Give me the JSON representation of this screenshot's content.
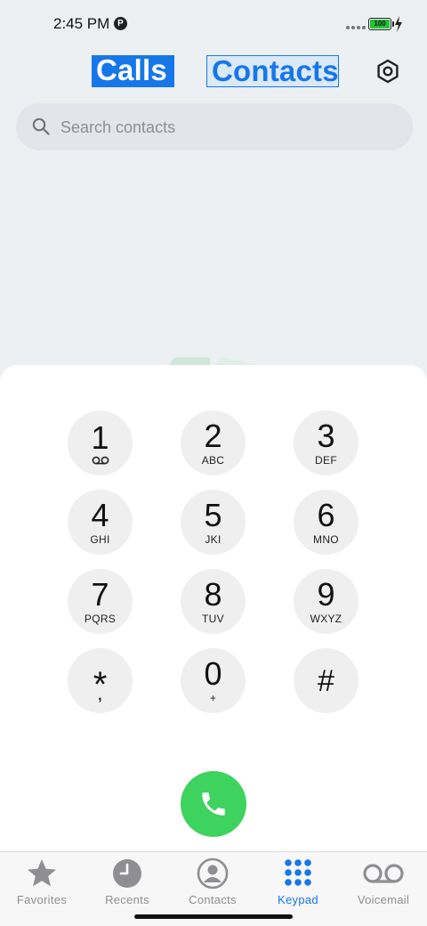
{
  "status": {
    "time": "2:45 PM",
    "pip_icon": "P",
    "battery_level": "100"
  },
  "header": {
    "tabs": [
      "Calls",
      "Contacts"
    ],
    "settings_icon": "gear-icon"
  },
  "search": {
    "placeholder": "Search contacts",
    "value": ""
  },
  "keypad": {
    "keys": [
      {
        "digit": "1",
        "sub": "",
        "icon": "voicemail-icon"
      },
      {
        "digit": "2",
        "sub": "ABC"
      },
      {
        "digit": "3",
        "sub": "DEF"
      },
      {
        "digit": "4",
        "sub": "GHI"
      },
      {
        "digit": "5",
        "sub": "JKI"
      },
      {
        "digit": "6",
        "sub": "MNO"
      },
      {
        "digit": "7",
        "sub": "PQRS"
      },
      {
        "digit": "8",
        "sub": "TUV"
      },
      {
        "digit": "9",
        "sub": "WXYZ"
      },
      {
        "digit": "*",
        "sub": ","
      },
      {
        "digit": "0",
        "sub": "+"
      },
      {
        "digit": "#",
        "sub": ""
      }
    ],
    "call_icon": "phone-icon"
  },
  "tabbar": {
    "items": [
      {
        "label": "Favorites",
        "icon": "star-icon"
      },
      {
        "label": "Recents",
        "icon": "clock-icon"
      },
      {
        "label": "Contacts",
        "icon": "person-circle-icon"
      },
      {
        "label": "Keypad",
        "icon": "keypad-icon"
      },
      {
        "label": "Voicemail",
        "icon": "voicemail-icon"
      }
    ],
    "active": "Keypad"
  },
  "colors": {
    "accent": "#1677e8",
    "call_green": "#3ed25f",
    "battery_green": "#22c33a",
    "inactive_tab": "#8e8e93"
  }
}
